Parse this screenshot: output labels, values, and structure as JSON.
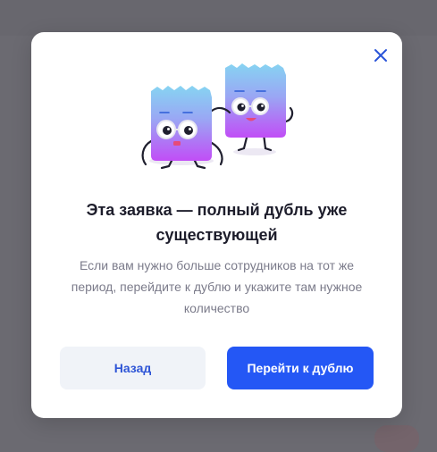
{
  "modal": {
    "title": "Эта заявка — полный дубль уже существующей",
    "subtitle": "Если вам нужно больше сотрудников на тот же период, перейдите к дублю и укажите там нужное количество",
    "back_label": "Назад",
    "go_label": "Перейти к дублю",
    "close_icon": "close-icon",
    "illustration": "two-mascots-illustration"
  },
  "colors": {
    "primary": "#2457f5",
    "secondary_bg": "#f0f3f8",
    "overlay": "#6b6a71",
    "mascot_top": "#7cc8f4",
    "mascot_bottom": "#bf4ef5"
  }
}
